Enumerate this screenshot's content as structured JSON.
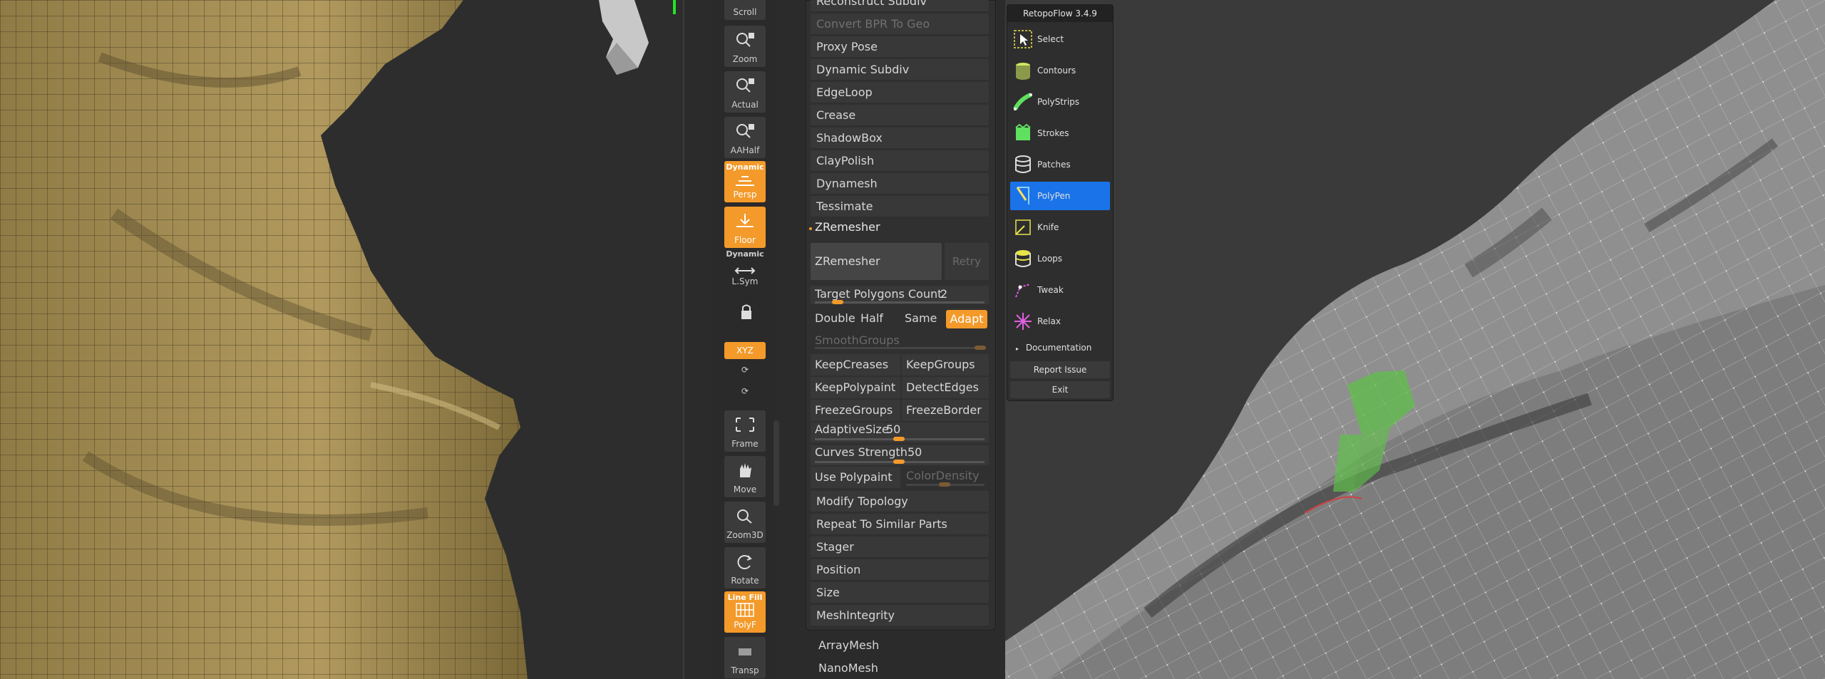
{
  "shelf": {
    "scroll": "Scroll",
    "zoom": "Zoom",
    "actual": "Actual",
    "aahalf": "AAHalf",
    "dynamic_top": "Dynamic",
    "persp": "Persp",
    "floor": "Floor",
    "dynamic_label": "Dynamic",
    "lsym": "L.Sym",
    "xyz": "XYZ",
    "frame": "Frame",
    "move": "Move",
    "zoom3d": "Zoom3D",
    "rotate": "Rotate",
    "linefill": "Line Fill",
    "polyf": "PolyF",
    "transp": "Transp"
  },
  "palette": {
    "items": [
      {
        "label": "Reconstruct Subdiv",
        "dim": false
      },
      {
        "label": "Convert BPR To Geo",
        "dim": true
      },
      {
        "label": "Proxy Pose",
        "dim": false
      },
      {
        "label": "Dynamic Subdiv",
        "dim": false
      },
      {
        "label": "EdgeLoop",
        "dim": false
      },
      {
        "label": "Crease",
        "dim": false
      },
      {
        "label": "ShadowBox",
        "dim": false
      },
      {
        "label": "ClayPolish",
        "dim": false
      },
      {
        "label": "Dynamesh",
        "dim": false
      },
      {
        "label": "Tessimate",
        "dim": false
      }
    ],
    "zremesher_header": "ZRemesher",
    "zremesher_button": "ZRemesher",
    "retry": "Retry",
    "target_label": "Target Polygons Count",
    "target_value": "2",
    "double": "Double",
    "half": "Half",
    "same": "Same",
    "adapt": "Adapt",
    "smoothgroups": "SmoothGroups",
    "keepcreases": "KeepCreases",
    "keepgroups": "KeepGroups",
    "keeppolypaint": "KeepPolypaint",
    "detectedges": "DetectEdges",
    "freezegroups": "FreezeGroups",
    "freezeborder": "FreezeBorder",
    "adaptivesize_label": "AdaptiveSize",
    "adaptivesize_value": "50",
    "curves_label": "Curves Strength",
    "curves_value": "50",
    "usepolypaint": "Use Polypaint",
    "colordensity": "ColorDensity",
    "items2": [
      "Modify Topology",
      "Repeat To Similar Parts",
      "Stager",
      "Position",
      "Size",
      "MeshIntegrity"
    ],
    "arraymesh": "ArrayMesh",
    "nanomesh": "NanoMesh"
  },
  "retopoflow": {
    "title": "RetopoFlow 3.4.9",
    "tools": [
      {
        "label": "Select",
        "icon": "select-icon",
        "active": false
      },
      {
        "label": "Contours",
        "icon": "contours-icon",
        "active": false
      },
      {
        "label": "PolyStrips",
        "icon": "polystrips-icon",
        "active": false
      },
      {
        "label": "Strokes",
        "icon": "strokes-icon",
        "active": false
      },
      {
        "label": "Patches",
        "icon": "patches-icon",
        "active": false
      },
      {
        "label": "PolyPen",
        "icon": "polypen-icon",
        "active": true
      },
      {
        "label": "Knife",
        "icon": "knife-icon",
        "active": false
      },
      {
        "label": "Loops",
        "icon": "loops-icon",
        "active": false
      },
      {
        "label": "Tweak",
        "icon": "tweak-icon",
        "active": false
      },
      {
        "label": "Relax",
        "icon": "relax-icon",
        "active": false
      }
    ],
    "documentation": "Documentation",
    "report_issue": "Report Issue",
    "exit": "Exit"
  },
  "colors": {
    "accent_orange": "#f39a2a",
    "active_blue": "#1a73e8",
    "mesh_gold": "#a8925a",
    "retopo_green": "#5fbf4a"
  }
}
